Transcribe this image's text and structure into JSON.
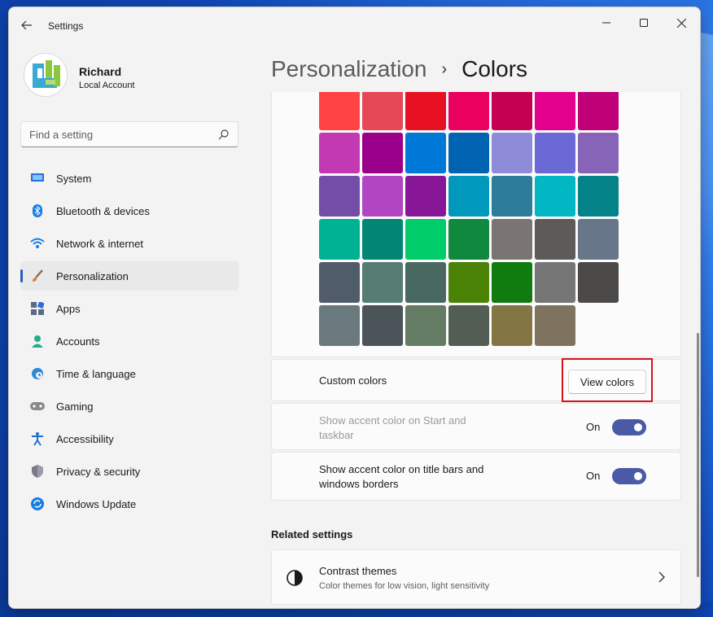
{
  "window": {
    "title": "Settings",
    "controls": [
      "minimize-icon",
      "maximize-icon",
      "close-icon"
    ]
  },
  "profile": {
    "name": "Richard",
    "account_type": "Local Account"
  },
  "search": {
    "placeholder": "Find a setting"
  },
  "nav": {
    "items": [
      {
        "label": "System",
        "icon": "system-icon",
        "active": false
      },
      {
        "label": "Bluetooth & devices",
        "icon": "bluetooth-icon",
        "active": false
      },
      {
        "label": "Network & internet",
        "icon": "wifi-icon",
        "active": false
      },
      {
        "label": "Personalization",
        "icon": "brush-icon",
        "active": true
      },
      {
        "label": "Apps",
        "icon": "apps-icon",
        "active": false
      },
      {
        "label": "Accounts",
        "icon": "person-icon",
        "active": false
      },
      {
        "label": "Time & language",
        "icon": "globe-clock-icon",
        "active": false
      },
      {
        "label": "Gaming",
        "icon": "gamepad-icon",
        "active": false
      },
      {
        "label": "Accessibility",
        "icon": "accessibility-icon",
        "active": false
      },
      {
        "label": "Privacy & security",
        "icon": "shield-icon",
        "active": false
      },
      {
        "label": "Windows Update",
        "icon": "update-icon",
        "active": false
      }
    ]
  },
  "breadcrumb": {
    "parent": "Personalization",
    "separator": "›",
    "current": "Colors"
  },
  "palette": {
    "rows": [
      [
        "#ff4343",
        "#e74856",
        "#e81123",
        "#ea005e",
        "#c30052",
        "#e3008c",
        "#bf0077"
      ],
      [
        "#c239b3",
        "#9a0089",
        "#0078d7",
        "#0063b1",
        "#8e8cd8",
        "#6b69d6",
        "#8764b8"
      ],
      [
        "#744da9",
        "#b146c2",
        "#881798",
        "#0099bc",
        "#2d7d9a",
        "#00b7c3",
        "#038387"
      ],
      [
        "#00b294",
        "#018574",
        "#00cc6a",
        "#10893e",
        "#7a7574",
        "#5d5a58",
        "#68768a"
      ],
      [
        "#515c6b",
        "#567c73",
        "#486860",
        "#498205",
        "#107c10",
        "#767676",
        "#4c4a48"
      ],
      [
        "#69797e",
        "#4a5459",
        "#647c64",
        "#525e54",
        "#847545",
        "#7e735f"
      ]
    ]
  },
  "custom_colors": {
    "label": "Custom colors",
    "button": "View colors"
  },
  "accent_start": {
    "label_line1": "Show accent color on Start and",
    "label_line2": "taskbar",
    "state": "On",
    "enabled": false
  },
  "accent_titlebars": {
    "label_line1": "Show accent color on title bars and",
    "label_line2": "windows borders",
    "state": "On"
  },
  "related": {
    "title": "Related settings",
    "contrast_title": "Contrast themes",
    "contrast_subtitle": "Color themes for low vision, light sensitivity"
  },
  "colors": {
    "accent": "#4b5aa6",
    "highlight": "#d3141c",
    "nav_indicator": "#2a5cc0"
  }
}
